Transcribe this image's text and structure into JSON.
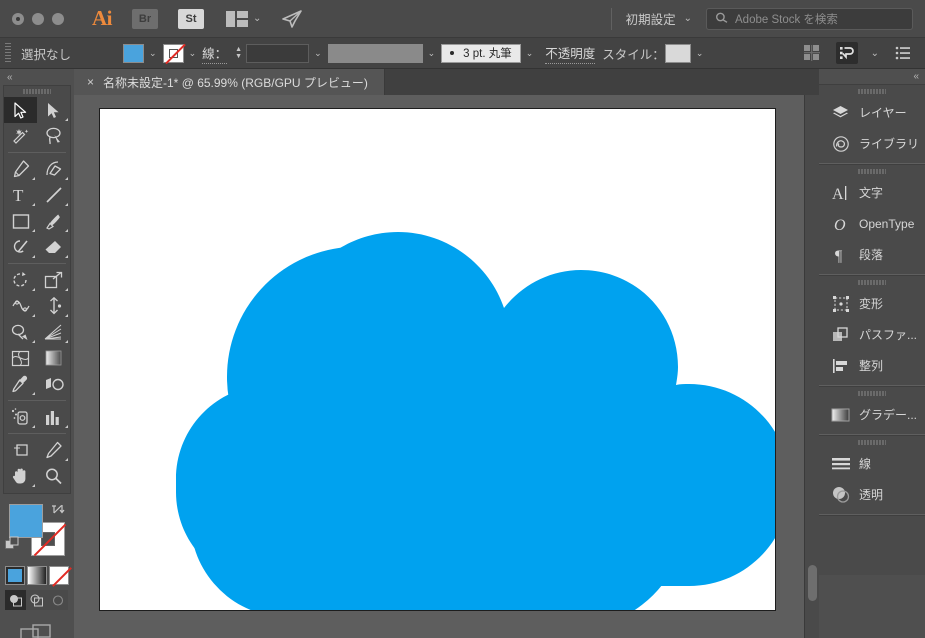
{
  "window": {
    "traffic_lights": [
      "close",
      "minimize",
      "zoom"
    ]
  },
  "titlebar": {
    "ai_logo": "Ai",
    "bridge_chip": "Br",
    "stock_chip": "St",
    "arrange_icon": "arrange-documents-icon",
    "chevron": "⌄",
    "plane_icon": "share-icon",
    "workspace_label": "初期設定",
    "workspace_chevron": "⌄",
    "search_icon": "search-icon",
    "search_placeholder": "Adobe Stock を検索",
    "search_value": ""
  },
  "controlbar": {
    "selection_label": "選択なし",
    "fill_swatch_name": "fill-swatch",
    "fill_color": "#4aa3dd",
    "stroke_swatch_name": "stroke-swatch",
    "stroke_color": "none",
    "stroke_label": "線：",
    "stroke_weight_value": "",
    "stroke_profile_value": "",
    "brush_label": "3 pt. 丸筆",
    "opacity_label": "不透明度",
    "style_label": "スタイル：",
    "style_swatch": "",
    "align_icon": "align-icon",
    "arrange_icon": "arrange-icon",
    "arrange_chevron": "⌄",
    "menu_icon": "options-menu-icon",
    "chevron": "⌄"
  },
  "tabs": {
    "close_glyph": "×",
    "title": "名称未設定-1* @ 65.99% (RGB/GPU プレビュー)"
  },
  "toolbar": {
    "collapse_glyph": "«",
    "groups": [
      {
        "tools": [
          {
            "name": "selection-tool",
            "glyph": "selection",
            "selected": true,
            "more": false
          },
          {
            "name": "direct-selection-tool",
            "glyph": "direct-selection",
            "selected": false,
            "more": true
          },
          {
            "name": "magic-wand-tool",
            "glyph": "magic-wand",
            "selected": false,
            "more": false
          },
          {
            "name": "lasso-tool",
            "glyph": "lasso",
            "selected": false,
            "more": false
          }
        ]
      },
      {
        "tools": [
          {
            "name": "pen-tool",
            "glyph": "pen",
            "selected": false,
            "more": true
          },
          {
            "name": "curvature-tool",
            "glyph": "curvature",
            "selected": false,
            "more": true
          },
          {
            "name": "type-tool",
            "glyph": "type",
            "selected": false,
            "more": true
          },
          {
            "name": "line-segment-tool",
            "glyph": "line",
            "selected": false,
            "more": true
          },
          {
            "name": "rectangle-tool",
            "glyph": "rectangle",
            "selected": false,
            "more": true
          },
          {
            "name": "paintbrush-tool",
            "glyph": "paintbrush",
            "selected": false,
            "more": true
          },
          {
            "name": "shaper-tool",
            "glyph": "shaper",
            "selected": false,
            "more": true
          },
          {
            "name": "eraser-tool",
            "glyph": "eraser",
            "selected": false,
            "more": true
          }
        ]
      },
      {
        "tools": [
          {
            "name": "rotate-tool",
            "glyph": "rotate",
            "selected": false,
            "more": true
          },
          {
            "name": "scale-tool",
            "glyph": "scale",
            "selected": false,
            "more": true
          },
          {
            "name": "width-tool",
            "glyph": "width",
            "selected": false,
            "more": true
          },
          {
            "name": "free-transform-tool",
            "glyph": "free-transform",
            "selected": false,
            "more": true
          },
          {
            "name": "shape-builder-tool",
            "glyph": "shape-builder",
            "selected": false,
            "more": true
          },
          {
            "name": "perspective-grid-tool",
            "glyph": "perspective-grid",
            "selected": false,
            "more": true
          },
          {
            "name": "mesh-tool",
            "glyph": "mesh",
            "selected": false,
            "more": false
          },
          {
            "name": "gradient-tool",
            "glyph": "gradient",
            "selected": false,
            "more": false
          },
          {
            "name": "eyedropper-tool",
            "glyph": "eyedropper",
            "selected": false,
            "more": true
          },
          {
            "name": "blend-tool",
            "glyph": "blend",
            "selected": false,
            "more": false
          }
        ]
      },
      {
        "tools": [
          {
            "name": "symbol-sprayer-tool",
            "glyph": "symbol-sprayer",
            "selected": false,
            "more": true
          },
          {
            "name": "column-graph-tool",
            "glyph": "column-graph",
            "selected": false,
            "more": true
          }
        ]
      },
      {
        "tools": [
          {
            "name": "artboard-tool",
            "glyph": "artboard",
            "selected": false,
            "more": false
          },
          {
            "name": "slice-tool",
            "glyph": "slice",
            "selected": false,
            "more": true
          },
          {
            "name": "hand-tool",
            "glyph": "hand",
            "selected": false,
            "more": true
          },
          {
            "name": "zoom-tool",
            "glyph": "zoom",
            "selected": false,
            "more": false
          }
        ]
      }
    ],
    "fill_color": "#4aa3dd",
    "stroke_color": "none",
    "swap_icon": "swap-fill-stroke-icon",
    "defaults_icon": "default-fill-stroke-icon",
    "modes": [
      {
        "name": "color-mode-button",
        "type": "color",
        "selected": true
      },
      {
        "name": "gradient-mode-button",
        "type": "gradient",
        "selected": false
      },
      {
        "name": "none-mode-button",
        "type": "none",
        "selected": false
      }
    ],
    "draw_modes": [
      {
        "name": "draw-normal-button",
        "selected": true
      },
      {
        "name": "draw-behind-button",
        "selected": false
      },
      {
        "name": "draw-inside-button",
        "selected": false
      }
    ],
    "screen_mode_icon": "change-screen-mode-icon"
  },
  "rightdock": {
    "collapse_glyph": "«",
    "groups": [
      {
        "items": [
          {
            "name": "panel-layers",
            "icon": "layers-icon",
            "label": "レイヤー"
          },
          {
            "name": "panel-libraries",
            "icon": "libraries-icon",
            "label": "ライブラリ"
          }
        ]
      },
      {
        "items": [
          {
            "name": "panel-character",
            "icon": "character-icon",
            "label": "文字"
          },
          {
            "name": "panel-opentype",
            "icon": "opentype-icon",
            "label": "OpenType"
          },
          {
            "name": "panel-paragraph",
            "icon": "paragraph-icon",
            "label": "段落"
          }
        ]
      },
      {
        "items": [
          {
            "name": "panel-transform",
            "icon": "transform-icon",
            "label": "変形"
          },
          {
            "name": "panel-pathfinder",
            "icon": "pathfinder-icon",
            "label": "パスファ..."
          },
          {
            "name": "panel-align",
            "icon": "align-icon",
            "label": "整列"
          }
        ]
      },
      {
        "items": [
          {
            "name": "panel-gradient",
            "icon": "gradient-icon",
            "label": "グラデー..."
          }
        ]
      },
      {
        "items": [
          {
            "name": "panel-stroke",
            "icon": "stroke-icon",
            "label": "線"
          },
          {
            "name": "panel-transparency",
            "icon": "transparency-icon",
            "label": "透明"
          }
        ]
      }
    ]
  },
  "canvas": {
    "background": "#5e5e5e",
    "artboard_color": "#ffffff",
    "artwork": {
      "name": "cloud-shape",
      "fill": "#00a2ef",
      "stroke": "none"
    },
    "scrollbar_name": "vertical-scrollbar"
  }
}
